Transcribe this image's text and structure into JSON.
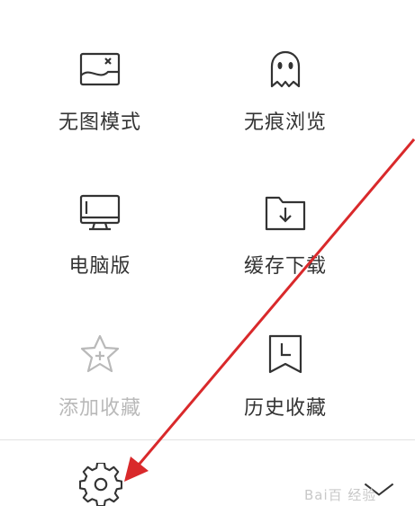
{
  "menu": {
    "items": [
      {
        "label": "无图模式",
        "icon": "no-image-icon",
        "enabled": true
      },
      {
        "label": "无痕浏览",
        "icon": "ghost-icon",
        "enabled": true
      },
      {
        "label": "电脑版",
        "icon": "desktop-monitor-icon",
        "enabled": true
      },
      {
        "label": "缓存下载",
        "icon": "folder-download-icon",
        "enabled": true
      },
      {
        "label": "添加收藏",
        "icon": "star-add-icon",
        "enabled": false
      },
      {
        "label": "历史收藏",
        "icon": "bookmark-clock-icon",
        "enabled": true
      }
    ]
  },
  "bottom_bar": {
    "settings_icon": "gear-icon",
    "collapse_icon": "chevron-down-icon"
  },
  "watermark": {
    "text": "Bai百 经验"
  },
  "annotation": {
    "arrow_color": "#d9292b"
  }
}
